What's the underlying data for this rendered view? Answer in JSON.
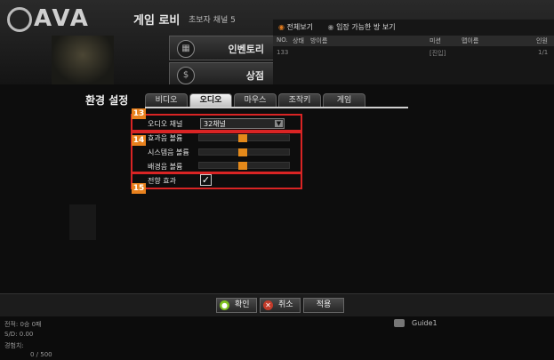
{
  "header": {
    "logo": "AVA",
    "lobby_title": "게임 로비",
    "lobby_channel": "초보자 채널 5",
    "side_buttons": [
      {
        "label": "인벤토리",
        "icon": "inventory-icon"
      },
      {
        "label": "상점",
        "icon": "shop-icon"
      }
    ],
    "room_tabs": [
      "전체보기",
      "입장 가능한 방 보기"
    ],
    "room_columns": [
      "NO.",
      "상태",
      "방이름",
      "미션",
      "맵이름",
      "인원"
    ],
    "room_row": {
      "no": "133",
      "status": "",
      "name": "",
      "mission": "[진입]",
      "map": "",
      "count": "1/1"
    }
  },
  "settings": {
    "title": "환경 설정",
    "tabs": [
      "비디오",
      "오디오",
      "마우스",
      "조작키",
      "게임"
    ],
    "active_tab": "오디오",
    "callouts": [
      "13",
      "14",
      "15"
    ],
    "audio_channel": {
      "label": "오디오 채널",
      "value": "32채널"
    },
    "sliders": [
      {
        "label": "효과음 볼륨",
        "level": 0.48
      },
      {
        "label": "시스템음 볼륨",
        "level": 0.48
      },
      {
        "label": "배경음 볼륨",
        "level": 0.48
      }
    ],
    "stereo": {
      "label": "전향 효과",
      "checked": "✓"
    }
  },
  "buttons": {
    "confirm": "확인",
    "cancel": "취소",
    "apply": "적용"
  },
  "status": {
    "record": "전적: 0승 0패",
    "sd": "S/D: 0.00",
    "exp_label": "경험치:",
    "exp_value": "0 / 500",
    "guide": "Guide1"
  },
  "colors": {
    "accent": "#e8811d",
    "highlight_box": "#d92424"
  }
}
